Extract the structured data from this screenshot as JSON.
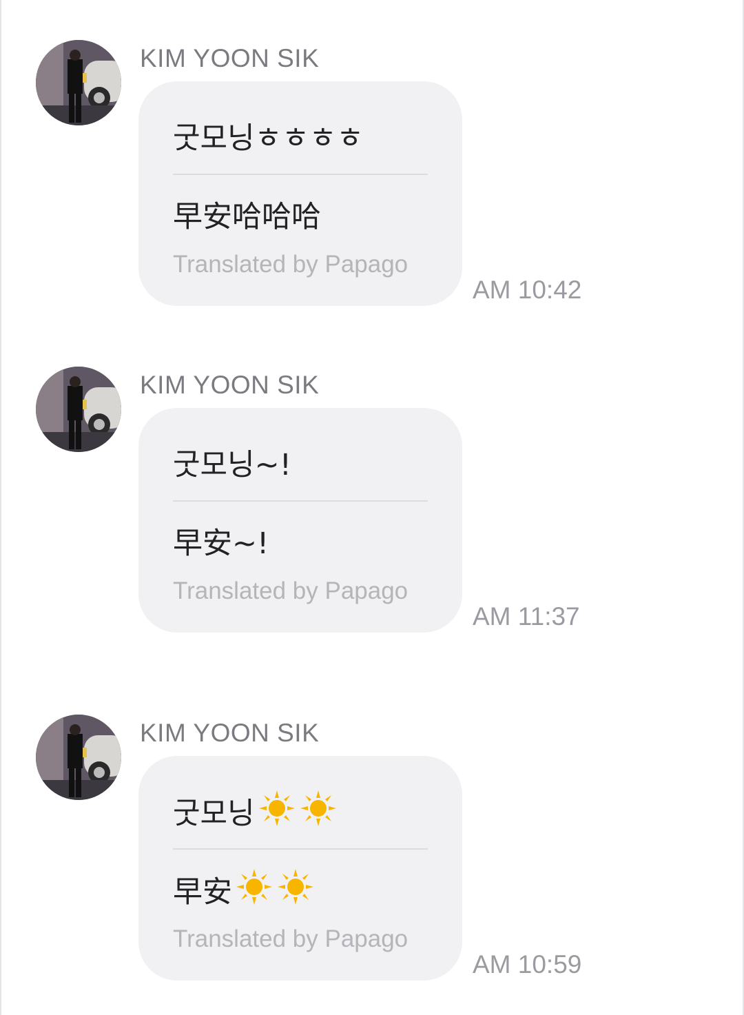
{
  "messages": [
    {
      "sender": "KIM YOON SIK",
      "original": "굿모닝ㅎㅎㅎㅎ",
      "translated": "早安哈哈哈",
      "credit": "Translated by Papago",
      "time": "AM 10:42"
    },
    {
      "sender": "KIM YOON SIK",
      "original": "굿모닝~!",
      "translated": "早安~!",
      "credit": "Translated by Papago",
      "time": "AM 11:37"
    },
    {
      "sender": "KIM YOON SIK",
      "original": "굿모닝",
      "original_emoji": [
        "sun-icon",
        "sun-icon"
      ],
      "translated": "早安",
      "translated_emoji": [
        "sun-icon",
        "sun-icon"
      ],
      "credit": "Translated by Papago",
      "time": "AM 10:59"
    }
  ],
  "colors": {
    "bubble": "#f1f1f3",
    "sender": "#7a7a80",
    "time": "#9a9aa0",
    "credit": "#b4b4b9",
    "sun": "#f7b500"
  }
}
